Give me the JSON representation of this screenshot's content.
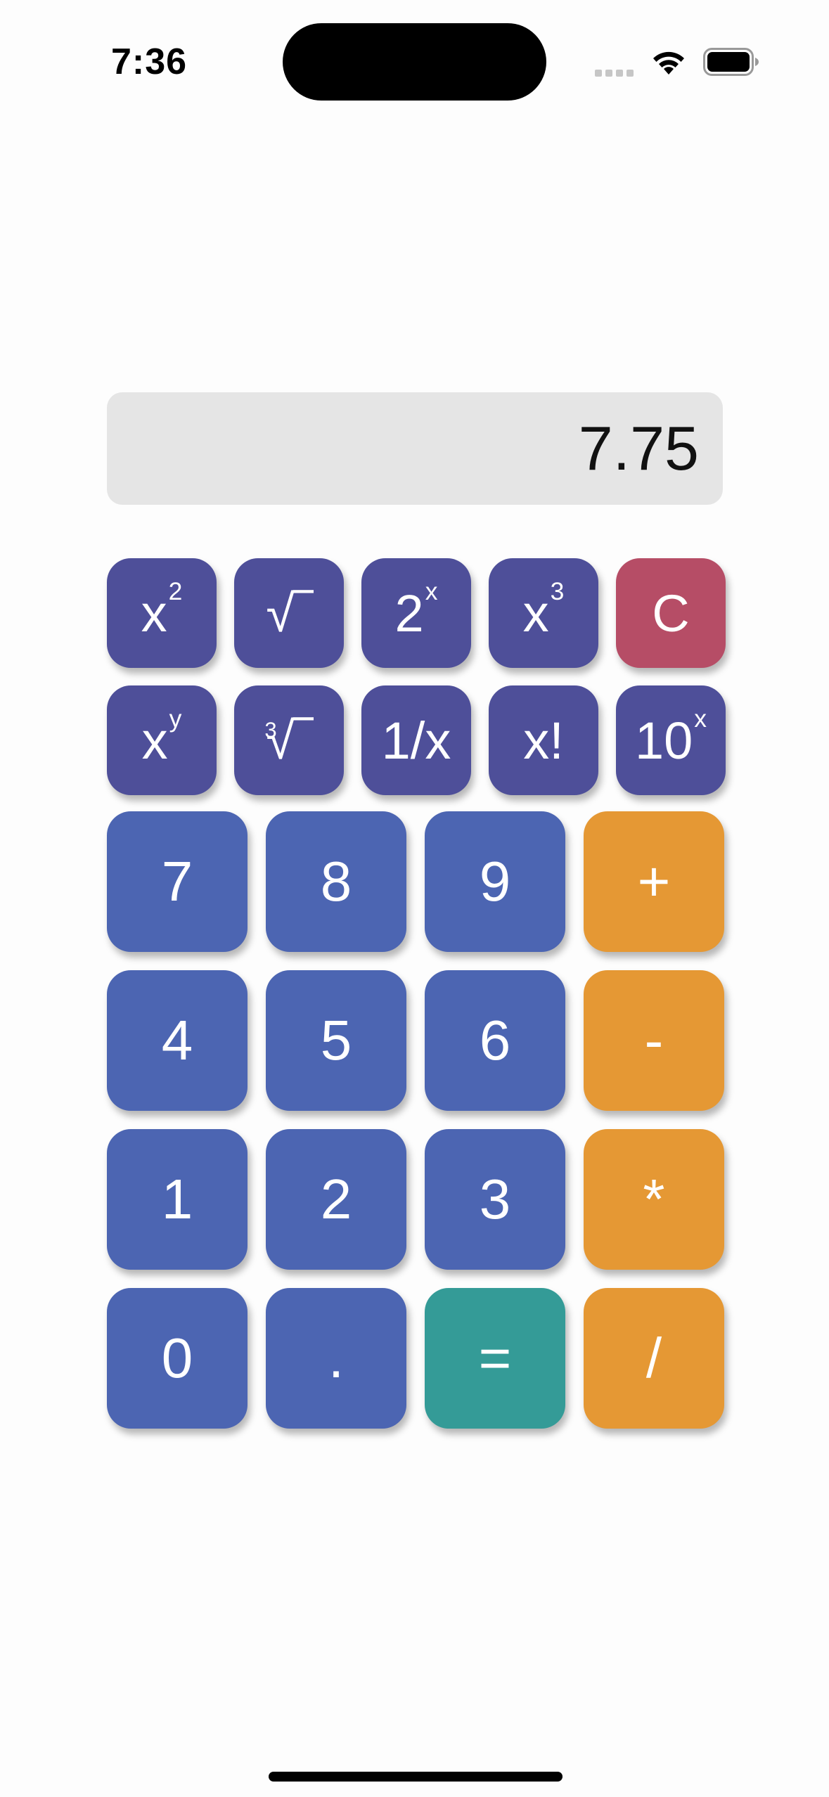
{
  "status_bar": {
    "time": "7:36"
  },
  "display": {
    "value": "7.75"
  },
  "keys": {
    "square": {
      "base": "x",
      "exp": "2"
    },
    "sqrt": {
      "label": "√‾"
    },
    "pow2": {
      "base": "2",
      "exp": "x"
    },
    "cube": {
      "base": "x",
      "exp": "3"
    },
    "clear": {
      "label": "C"
    },
    "power": {
      "base": "x",
      "exp": "y"
    },
    "cbrt": {
      "index": "3",
      "label": "√‾"
    },
    "reciprocal": {
      "label": "1/x"
    },
    "factorial": {
      "label": "x!"
    },
    "pow10": {
      "base": "10",
      "exp": "x"
    },
    "d7": "7",
    "d8": "8",
    "d9": "9",
    "plus": "+",
    "d4": "4",
    "d5": "5",
    "d6": "6",
    "minus": "-",
    "d1": "1",
    "d2": "2",
    "d3": "3",
    "multiply": "*",
    "d0": "0",
    "dot": ".",
    "equals": "=",
    "divide": "/"
  },
  "colors": {
    "function_key": "#4e4f99",
    "clear_key": "#b64d66",
    "number_key": "#4c65b2",
    "operator_key": "#e59834",
    "equals_key": "#349b97",
    "display_bg": "#e5e5e5"
  },
  "icons": [
    "wifi-icon",
    "battery-icon",
    "cell-signal-icon"
  ]
}
